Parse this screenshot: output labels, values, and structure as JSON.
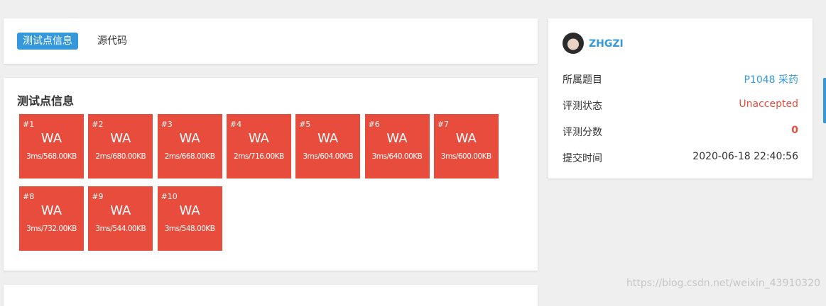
{
  "tabs": [
    {
      "label": "测试点信息",
      "active": true
    },
    {
      "label": "源代码",
      "active": false
    }
  ],
  "section_title": "测试点信息",
  "tile_color": "#e74c3c",
  "accent_color": "#3498db",
  "tests": [
    {
      "id": "#1",
      "status": "WA",
      "stat": "3ms/568.00KB"
    },
    {
      "id": "#2",
      "status": "WA",
      "stat": "2ms/680.00KB"
    },
    {
      "id": "#3",
      "status": "WA",
      "stat": "2ms/668.00KB"
    },
    {
      "id": "#4",
      "status": "WA",
      "stat": "2ms/716.00KB"
    },
    {
      "id": "#5",
      "status": "WA",
      "stat": "3ms/604.00KB"
    },
    {
      "id": "#6",
      "status": "WA",
      "stat": "3ms/640.00KB"
    },
    {
      "id": "#7",
      "status": "WA",
      "stat": "3ms/600.00KB"
    },
    {
      "id": "#8",
      "status": "WA",
      "stat": "3ms/732.00KB"
    },
    {
      "id": "#9",
      "status": "WA",
      "stat": "3ms/544.00KB"
    },
    {
      "id": "#10",
      "status": "WA",
      "stat": "3ms/548.00KB"
    }
  ],
  "user": {
    "name": "ZHGZI",
    "avatar_icon": "user-avatar-icon"
  },
  "info": [
    {
      "label": "所属题目",
      "value": "P1048 采药"
    },
    {
      "label": "评测状态",
      "value": "Unaccepted"
    },
    {
      "label": "评测分数",
      "value": "0"
    },
    {
      "label": "提交时间",
      "value": "2020-06-18 22:40:56"
    }
  ],
  "watermark": "https://blog.csdn.net/weixin_43910320"
}
